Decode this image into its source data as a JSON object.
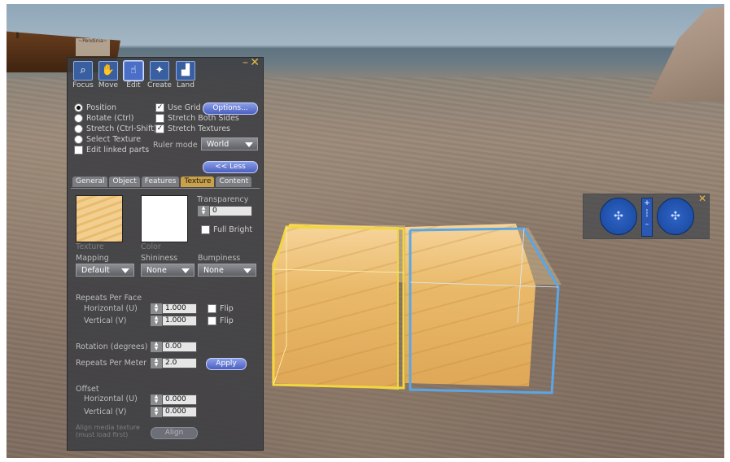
{
  "toolbar": {
    "tools": [
      {
        "label": "Focus",
        "icon": "magnifier-icon"
      },
      {
        "label": "Move",
        "icon": "hand-icon"
      },
      {
        "label": "Edit",
        "icon": "edit-hand-icon"
      },
      {
        "label": "Create",
        "icon": "wand-icon"
      },
      {
        "label": "Land",
        "icon": "land-icon"
      }
    ],
    "selected": "Edit",
    "minimize": "–",
    "close": "✕"
  },
  "edit_options": {
    "radios": [
      "Position",
      "Rotate (Ctrl)",
      "Stretch (Ctrl-Shift)",
      "Select Texture"
    ],
    "edit_linked": "Edit linked parts",
    "use_grid": "Use Grid",
    "options_button": "Options...",
    "stretch_both_sides": "Stretch Both Sides",
    "stretch_textures": "Stretch Textures",
    "ruler_label": "Ruler mode",
    "ruler_value": "World",
    "less_button": "<< Less"
  },
  "tabs": [
    "General",
    "Object",
    "Features",
    "Texture",
    "Content"
  ],
  "active_tab": "Texture",
  "texture": {
    "texture_label": "Texture",
    "color_label": "Color",
    "transparency_label": "Transparency",
    "transparency_value": "0",
    "full_bright": "Full Bright",
    "mapping_label": "Mapping",
    "mapping_value": "Default",
    "shininess_label": "Shininess",
    "shininess_value": "None",
    "bumpiness_label": "Bumpiness",
    "bumpiness_value": "None",
    "repeats_per_face": "Repeats Per Face",
    "horizontal_u": "Horizontal (U)",
    "vertical_v": "Vertical (V)",
    "repeats_h": "1.000",
    "repeats_v": "1.000",
    "flip": "Flip",
    "rotation_label": "Rotation (degrees)",
    "rotation_value": "0.00",
    "repeats_per_meter_label": "Repeats Per Meter",
    "repeats_per_meter_value": "2.0",
    "apply_button": "Apply",
    "offset_label": "Offset",
    "offset_h": "0.000",
    "offset_v": "0.000",
    "align_hint": "Align media texture (must load first)",
    "align_button": "Align"
  },
  "nav": {
    "close": "✕",
    "slider_plus": "+",
    "slider_minus": "–"
  },
  "scene": {
    "ship_sign": "~Pendinia~"
  },
  "colors": {
    "accent_gold": "#c9a14a",
    "button_blue": "#4b5fc0",
    "selection_yellow": "#f2d640",
    "selection_blue": "#5aa6e6"
  }
}
